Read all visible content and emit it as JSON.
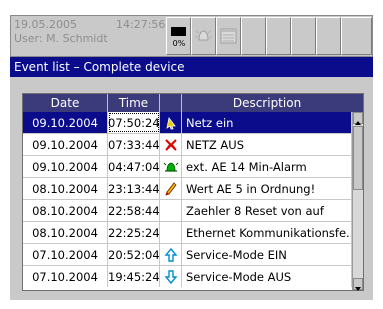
{
  "status_bar": {
    "date": "19.05.2005",
    "time": "14:27:56",
    "user": "User: M. Schmidt",
    "gauge_label": "0%",
    "icons": [
      "memory-gauge-icon",
      "alarm-bell-icon",
      "calendar-icon",
      "blank",
      "blank",
      "blank",
      "blank",
      "blank"
    ]
  },
  "window": {
    "title": "Event list – Complete device"
  },
  "table": {
    "columns": [
      "Date",
      "Time",
      "",
      "Description"
    ],
    "rows": [
      {
        "date": "09.10.2004",
        "time": "07:50:24",
        "icon": "pointer-icon",
        "desc": "Netz ein",
        "selected": true
      },
      {
        "date": "09.10.2004",
        "time": "07:33:44",
        "icon": "power-off-icon",
        "desc": "NETZ AUS",
        "selected": false
      },
      {
        "date": "09.10.2004",
        "time": "04:47:04",
        "icon": "alarm-bell-icon",
        "desc": "ext. AE 14 Min-Alarm",
        "selected": false
      },
      {
        "date": "08.10.2004",
        "time": "23:13:44",
        "icon": "pencil-icon",
        "desc": "Wert AE 5 in Ordnung!",
        "selected": false
      },
      {
        "date": "08.10.2004",
        "time": "22:58:44",
        "icon": "",
        "desc": "Zaehler 8 Reset von auf",
        "selected": false
      },
      {
        "date": "08.10.2004",
        "time": "22:25:24",
        "icon": "",
        "desc": "Ethernet Kommunikationsfe...",
        "selected": false
      },
      {
        "date": "07.10.2004",
        "time": "20:52:04",
        "icon": "arrow-up-icon",
        "desc": "Service-Mode EIN",
        "selected": false
      },
      {
        "date": "07.10.2004",
        "time": "19:45:24",
        "icon": "arrow-down-icon",
        "desc": "Service-Mode AUS",
        "selected": false
      }
    ]
  },
  "colors": {
    "title_bg": "#0a0c8c",
    "header_bg": "#3b3b7c",
    "panel_bg": "#c9c9c9",
    "selection_bg": "#0a0c8c"
  }
}
